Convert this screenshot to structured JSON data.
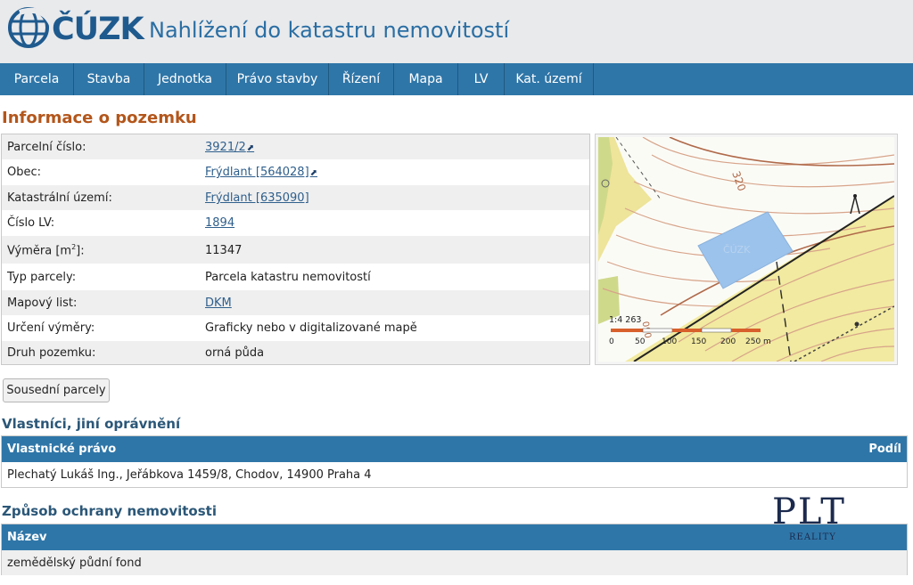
{
  "header": {
    "logo_text": "ČÚZK",
    "title": "Nahlížení do katastru nemovitostí"
  },
  "nav": {
    "items": [
      {
        "label": "Parcela"
      },
      {
        "label": "Stavba"
      },
      {
        "label": "Jednotka"
      },
      {
        "label": "Právo stavby"
      },
      {
        "label": "Řízení"
      },
      {
        "label": "Mapa"
      },
      {
        "label": "LV"
      },
      {
        "label": "Kat. území"
      }
    ]
  },
  "parcel": {
    "section_title": "Informace o pozemku",
    "rows": [
      {
        "label": "Parcelní číslo:",
        "value": "3921/2",
        "link": true,
        "external": true
      },
      {
        "label": "Obec:",
        "value": "Frýdlant [564028]",
        "link": true,
        "external": true
      },
      {
        "label": "Katastrální území:",
        "value": "Frýdlant [635090]",
        "link": true,
        "external": false
      },
      {
        "label": "Číslo LV:",
        "value": "1894",
        "link": true,
        "external": false
      },
      {
        "label": "Výměra [m",
        "label_sup": "2",
        "label_after": "]:",
        "value": "11347",
        "link": false
      },
      {
        "label": "Typ parcely:",
        "value": "Parcela katastru nemovitostí",
        "link": false
      },
      {
        "label": "Mapový list:",
        "value": "DKM",
        "link": true,
        "external": false
      },
      {
        "label": "Určení výměry:",
        "value": "Graficky nebo v digitalizované mapě",
        "link": false
      },
      {
        "label": "Druh pozemku:",
        "value": "orná půda",
        "link": false
      }
    ],
    "external_link_icon": "external-link-icon"
  },
  "map": {
    "scale_text": "1:4 263",
    "scale_labels": [
      "0",
      "50",
      "100",
      "150",
      "200",
      "250 m"
    ],
    "contour_label": "320",
    "contour_label_2": "050",
    "watermark": "ČÚZK",
    "parcel_color": "#9cc3ec"
  },
  "buttons": {
    "neighbors": "Sousední parcely"
  },
  "owners": {
    "title": "Vlastníci, jiní oprávnění",
    "col_right": "Vlastnické právo",
    "col_share": "Podíl",
    "rows": [
      "Plechatý Lukáš Ing., Jeřábkova 1459/8, Chodov, 14900 Praha 4"
    ]
  },
  "protection": {
    "title": "Způsob ochrany nemovitosti",
    "col_name": "Název",
    "rows": [
      "zemědělský půdní fond"
    ]
  },
  "watermark": {
    "brand": "PLT",
    "sub": "REALITY"
  },
  "colors": {
    "nav_bg": "#2f76a8",
    "section_title": "#b3561b",
    "subheading": "#2b5778",
    "link": "#2f5f8c"
  }
}
